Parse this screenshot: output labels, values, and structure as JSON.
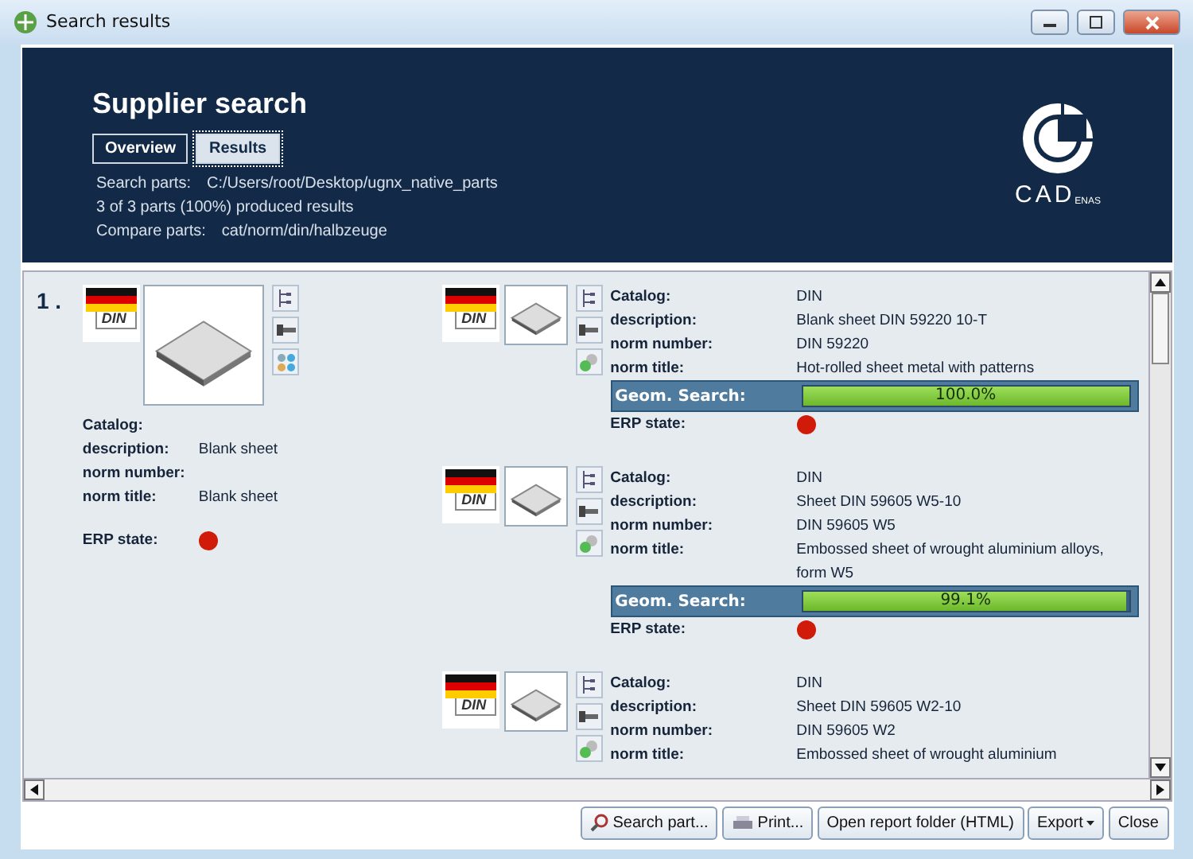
{
  "window": {
    "title": "Search results"
  },
  "header": {
    "title": "Supplier search",
    "tabs": [
      {
        "label": "Overview",
        "selected": false
      },
      {
        "label": "Results",
        "selected": true
      }
    ],
    "info": [
      {
        "label": "Search parts:",
        "value": "C:/Users/root/Desktop/ugnx_native_parts"
      },
      {
        "label": "3 of 3 parts (100%) produced results"
      },
      {
        "label": "Compare parts:",
        "value": "cat/norm/din/halbzeuge"
      }
    ],
    "logo": {
      "text": "CAD",
      "subtext": "ENAS"
    }
  },
  "results": [
    {
      "index": "1 .",
      "query": {
        "flag_text": "DIN",
        "fields": [
          {
            "label": "Catalog:"
          },
          {
            "label": "description:",
            "value": "Blank sheet"
          },
          {
            "label": "norm number:"
          },
          {
            "label": "norm title:",
            "value": "Blank sheet"
          }
        ],
        "erp": {
          "label": "ERP state:",
          "color": "#d01a0a"
        }
      },
      "matches": [
        {
          "flag_text": "DIN",
          "fields": [
            {
              "label": "Catalog:",
              "value": "DIN"
            },
            {
              "label": "description:",
              "value": "Blank sheet DIN 59220 10-T"
            },
            {
              "label": "norm number:",
              "value": "DIN 59220"
            },
            {
              "label": "norm title:",
              "value": "Hot-rolled sheet metal with patterns"
            }
          ],
          "geom": {
            "label": "Geom. Search:",
            "reading": "100.0%",
            "level": 1.0
          },
          "erp": {
            "label": "ERP state:",
            "color": "#d01a0a"
          }
        },
        {
          "flag_text": "DIN",
          "fields": [
            {
              "label": "Catalog:",
              "value": "DIN"
            },
            {
              "label": "description:",
              "value": "Sheet DIN 59605 W5-10"
            },
            {
              "label": "norm number:",
              "value": "DIN 59605 W5"
            },
            {
              "label": "norm title:",
              "value": "Embossed sheet of wrought aluminium alloys, form W5"
            }
          ],
          "geom": {
            "label": "Geom. Search:",
            "reading": "99.1%",
            "level": 0.991
          },
          "erp": {
            "label": "ERP state:",
            "color": "#d01a0a"
          }
        },
        {
          "flag_text": "DIN",
          "fields": [
            {
              "label": "Catalog:",
              "value": "DIN"
            },
            {
              "label": "description:",
              "value": "Sheet DIN 59605 W2-10"
            },
            {
              "label": "norm number:",
              "value": "DIN 59605 W2"
            },
            {
              "label": "norm title:",
              "value": "Embossed sheet of wrought aluminium"
            }
          ]
        }
      ]
    }
  ],
  "buttons": [
    {
      "label": "Search part...",
      "kind": "search"
    },
    {
      "label": "Print...",
      "kind": "print"
    },
    {
      "label": "Open report folder (HTML)",
      "kind": "plain"
    },
    {
      "label": "Export",
      "kind": "dropdown"
    },
    {
      "label": "Close",
      "kind": "plain"
    }
  ]
}
